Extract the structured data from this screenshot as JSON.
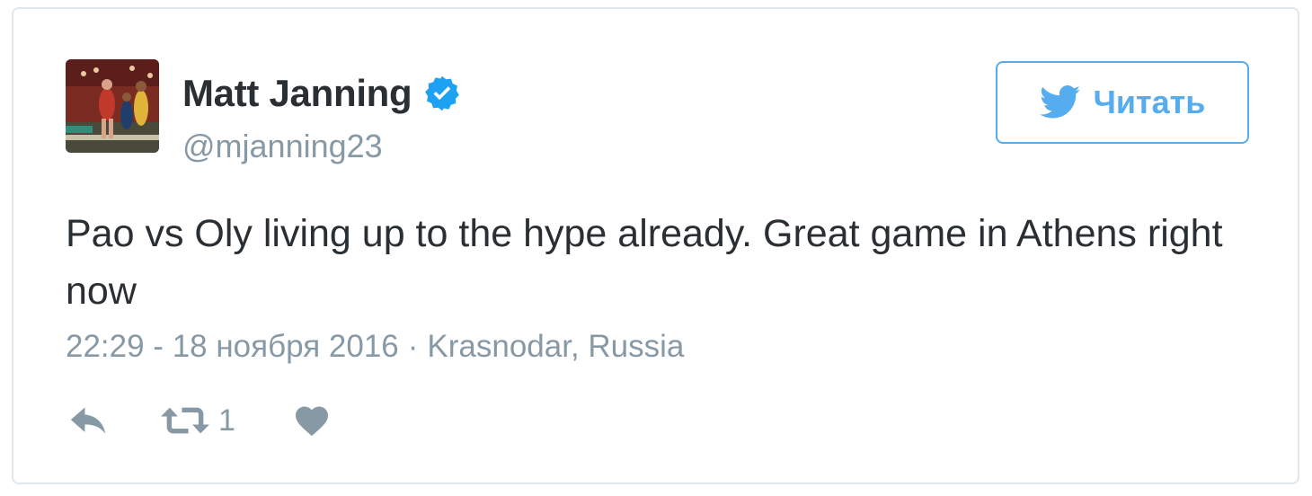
{
  "author": {
    "display_name": "Matt Janning",
    "handle": "@mjanning23",
    "verified": true
  },
  "follow_button": {
    "label": "Читать",
    "icon": "twitter-bird-icon"
  },
  "tweet": {
    "text": "Pao vs Oly living up to the hype already. Great game in Athens right now",
    "time": "22:29 - 18 ноября 2016",
    "separator": "·",
    "location": "Krasnodar, Russia"
  },
  "actions": {
    "reply_icon": "reply-icon",
    "retweet_icon": "retweet-icon",
    "retweet_count": "1",
    "like_icon": "heart-icon"
  },
  "colors": {
    "accent": "#55acee",
    "text": "#292f33",
    "muted": "#8899a6",
    "verified": "#1da1f2",
    "border": "#e1e8ed"
  }
}
